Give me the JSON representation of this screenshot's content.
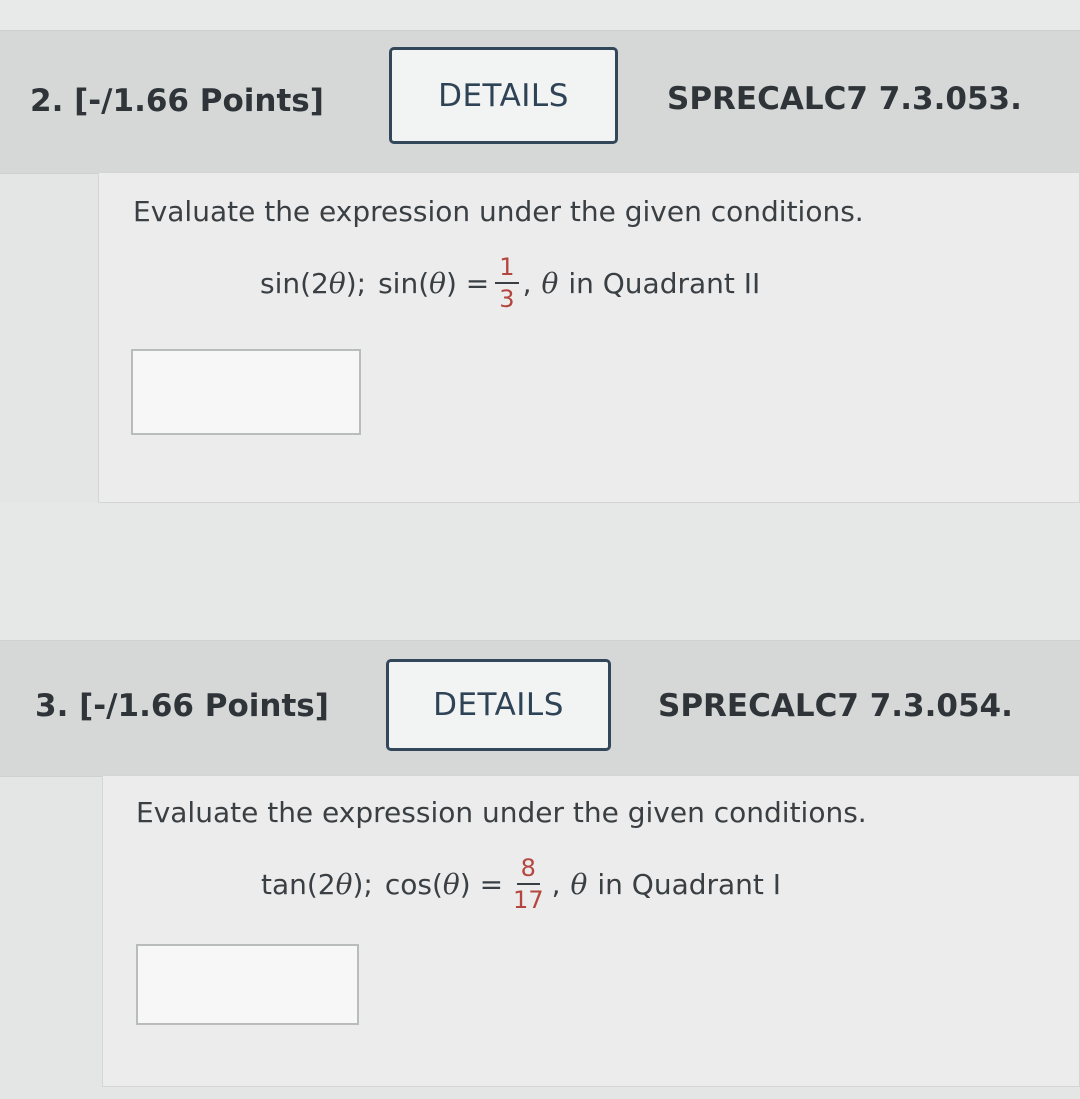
{
  "questions": [
    {
      "number_label": "2. [-/1.66 Points]",
      "details_label": "DETAILS",
      "code": "SPRECALC7 7.3.053.",
      "instruction": "Evaluate the expression under the given conditions.",
      "expression": "sin(2",
      "expression_close": ");",
      "given_func": "sin(",
      "given_close": ") =",
      "fraction_numerator": "1",
      "fraction_denominator": "3",
      "condition_prefix": ",",
      "condition_text": "in Quadrant II",
      "theta": "θ",
      "answer_value": ""
    },
    {
      "number_label": "3. [-/1.66 Points]",
      "details_label": "DETAILS",
      "code": "SPRECALC7 7.3.054.",
      "instruction": "Evaluate the expression under the given conditions.",
      "expression": "tan(2",
      "expression_close": ");",
      "given_func": "cos(",
      "given_close": ") =",
      "fraction_numerator": "8",
      "fraction_denominator": "17",
      "condition_prefix": ",",
      "condition_text": "in Quadrant I",
      "theta": "θ",
      "answer_value": ""
    }
  ],
  "colors": {
    "header_bg": "#d6d8d8",
    "button_border": "#33475a",
    "fraction_color": "#b3463e",
    "text": "#2e3438"
  }
}
